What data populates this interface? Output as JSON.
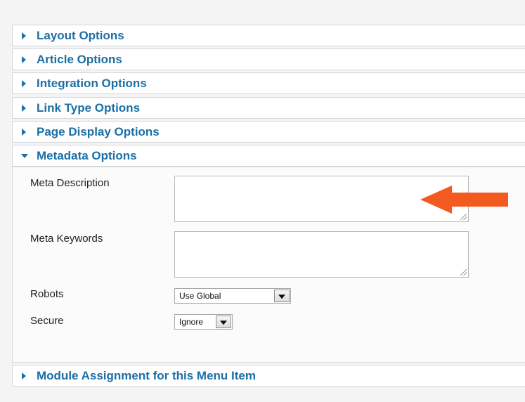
{
  "sections": [
    {
      "label": "Layout Options",
      "expanded": false
    },
    {
      "label": "Article Options",
      "expanded": false
    },
    {
      "label": "Integration Options",
      "expanded": false
    },
    {
      "label": "Link Type Options",
      "expanded": false
    },
    {
      "label": "Page Display Options",
      "expanded": false
    },
    {
      "label": "Metadata Options",
      "expanded": true
    },
    {
      "label": "Module Assignment for this Menu Item",
      "expanded": false
    }
  ],
  "metadata": {
    "meta_description_label": "Meta Description",
    "meta_description_value": "",
    "meta_keywords_label": "Meta Keywords",
    "meta_keywords_value": "",
    "robots_label": "Robots",
    "robots_value": "Use Global",
    "secure_label": "Secure",
    "secure_value": "Ignore"
  },
  "colors": {
    "accent": "#1b6fa6",
    "annotation_arrow": "#f25a1f"
  },
  "icons": [
    "expand-arrow-icon",
    "collapse-arrow-icon",
    "dropdown-arrow-icon",
    "annotation-arrow-icon"
  ]
}
